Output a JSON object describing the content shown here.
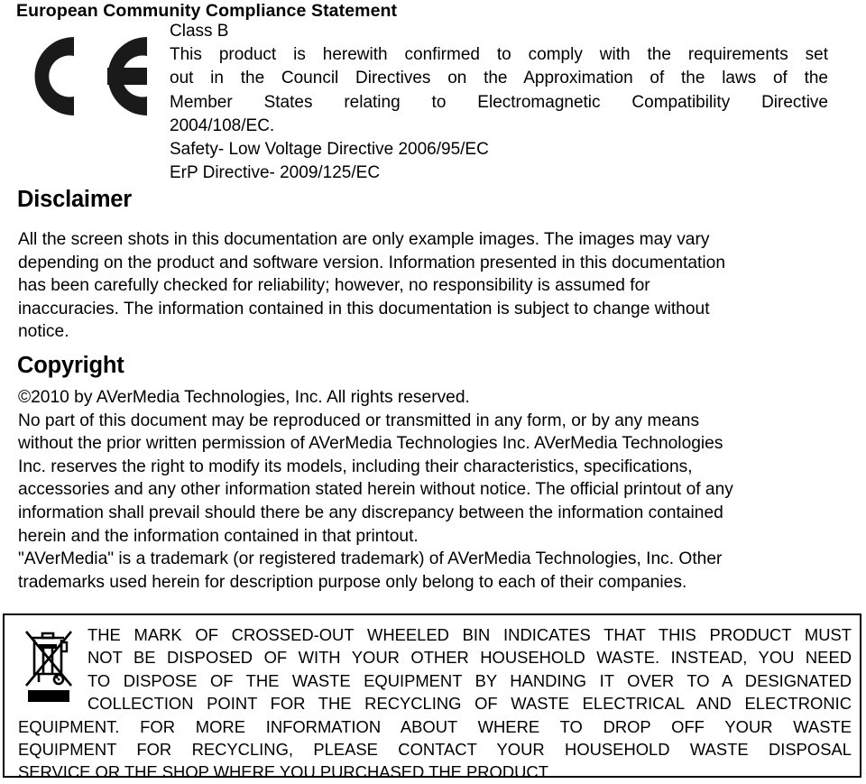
{
  "ec_section": {
    "heading": "European Community Compliance Statement",
    "class_label": "Class B",
    "statement_lines": [
      "This product is herewith confirmed to comply with the requirements set",
      "out in the Council Directives on the Approximation of the laws of the",
      "Member States relating to Electromagnetic Compatibility Directive",
      "2004/108/EC."
    ],
    "statement_full": "This product is herewith confirmed to comply with the requirements set out in the Council Directives on the Approximation of the laws of the Member States relating to Electromagnetic Compatibility Directive 2004/108/EC.",
    "safety_directive": "Safety- Low Voltage Directive 2006/95/EC",
    "erp_directive": "ErP Directive- 2009/125/EC",
    "ce_mark_alt": "CE"
  },
  "disclaimer": {
    "heading": "Disclaimer",
    "lines": [
      "All the screen shots in this documentation are only example images. The images may vary",
      "depending on the product and software version. Information presented in this documentation",
      "has been carefully checked for reliability; however, no responsibility is assumed for",
      "inaccuracies. The information contained in this documentation is subject to change without",
      "notice."
    ],
    "text": "All the screen shots in this documentation are only example images. The images may vary depending on the product and software version. Information presented in this documentation has been carefully checked for reliability; however, no responsibility is assumed for inaccuracies. The information contained in this documentation is subject to change without notice."
  },
  "copyright": {
    "heading": "Copyright",
    "lines": [
      "©2010 by AVerMedia Technologies, Inc. All rights reserved.",
      "No part of this document may be reproduced or transmitted in any form, or by any means",
      "without the prior written permission of AVerMedia Technologies Inc. AVerMedia Technologies",
      "Inc. reserves the right to modify its models, including their characteristics, specifications,",
      "accessories and any other information stated herein without notice. The official printout of any",
      "information shall prevail should there be any discrepancy between the information contained",
      "herein and the information contained in that printout.",
      "\"AVerMedia\" is a trademark (or registered trademark) of AVerMedia Technologies, Inc. Other",
      "trademarks used herein for description purpose only belong to each of their companies."
    ],
    "notice_line": "©2010 by AVerMedia Technologies, Inc. All rights reserved.",
    "year": "2010",
    "company": "AVerMedia Technologies, Inc."
  },
  "weee_notice": {
    "icon_alt": "crossed-out-wheeled-bin",
    "lines": [
      "THE MARK OF CROSSED-OUT WHEELED BIN INDICATES THAT THIS PRODUCT MUST",
      "NOT BE DISPOSED OF WITH YOUR OTHER HOUSEHOLD WASTE. INSTEAD, YOU NEED",
      "TO DISPOSE OF THE WASTE EQUIPMENT BY HANDING IT OVER TO A DESIGNATED",
      "COLLECTION POINT FOR THE RECYCLING OF WASTE ELECTRICAL AND ELECTRONIC",
      "EQUIPMENT. FOR MORE INFORMATION ABOUT WHERE TO DROP OFF YOUR WASTE",
      "EQUIPMENT FOR RECYCLING, PLEASE CONTACT YOUR HOUSEHOLD WASTE DISPOSAL",
      "SERVICE OR THE SHOP WHERE YOU PURCHASED THE PRODUCT."
    ],
    "text": "THE MARK OF CROSSED-OUT WHEELED BIN INDICATES THAT THIS PRODUCT MUST NOT BE DISPOSED OF WITH YOUR OTHER HOUSEHOLD WASTE. INSTEAD, YOU NEED TO DISPOSE OF THE WASTE EQUIPMENT BY HANDING IT OVER TO A DESIGNATED COLLECTION POINT FOR THE RECYCLING OF WASTE ELECTRICAL AND ELECTRONIC EQUIPMENT. FOR MORE INFORMATION ABOUT WHERE TO DROP OFF YOUR WASTE EQUIPMENT FOR RECYCLING, PLEASE CONTACT YOUR HOUSEHOLD WASTE DISPOSAL SERVICE OR THE SHOP WHERE YOU PURCHASED THE PRODUCT."
  },
  "colors": {
    "text": "#000000",
    "background": "#ffffff",
    "border": "#000000"
  }
}
